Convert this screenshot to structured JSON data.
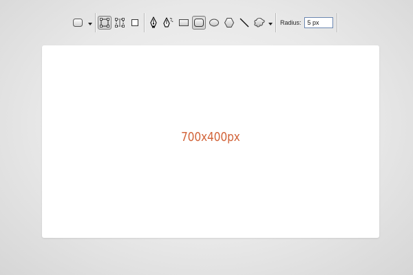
{
  "toolbar": {
    "tools": [
      {
        "id": "tool-preset",
        "icon": "rounded-rect-preset-icon"
      },
      {
        "id": "shape-layers",
        "icon": "shape-layers-icon"
      },
      {
        "id": "paths",
        "icon": "paths-icon"
      },
      {
        "id": "fill-pixels",
        "icon": "fill-pixels-icon"
      },
      {
        "id": "pen",
        "icon": "pen-tool-icon"
      },
      {
        "id": "freeform-pen",
        "icon": "freeform-pen-icon"
      },
      {
        "id": "rectangle",
        "icon": "rectangle-tool-icon"
      },
      {
        "id": "rounded-rectangle",
        "icon": "rounded-rectangle-tool-icon",
        "active": true
      },
      {
        "id": "ellipse",
        "icon": "ellipse-tool-icon"
      },
      {
        "id": "polygon",
        "icon": "polygon-tool-icon"
      },
      {
        "id": "line",
        "icon": "line-tool-icon"
      },
      {
        "id": "custom-shape",
        "icon": "custom-shape-tool-icon"
      }
    ],
    "radius_label": "Radius:",
    "radius_value": "5 px"
  },
  "canvas": {
    "label": "700x400px",
    "label_color": "#d2643a",
    "background": "#ffffff"
  },
  "colors": {
    "page_background": "#e4e4e4",
    "active_tool_border": "#7f7f7f",
    "input_border": "#6a86b0"
  }
}
